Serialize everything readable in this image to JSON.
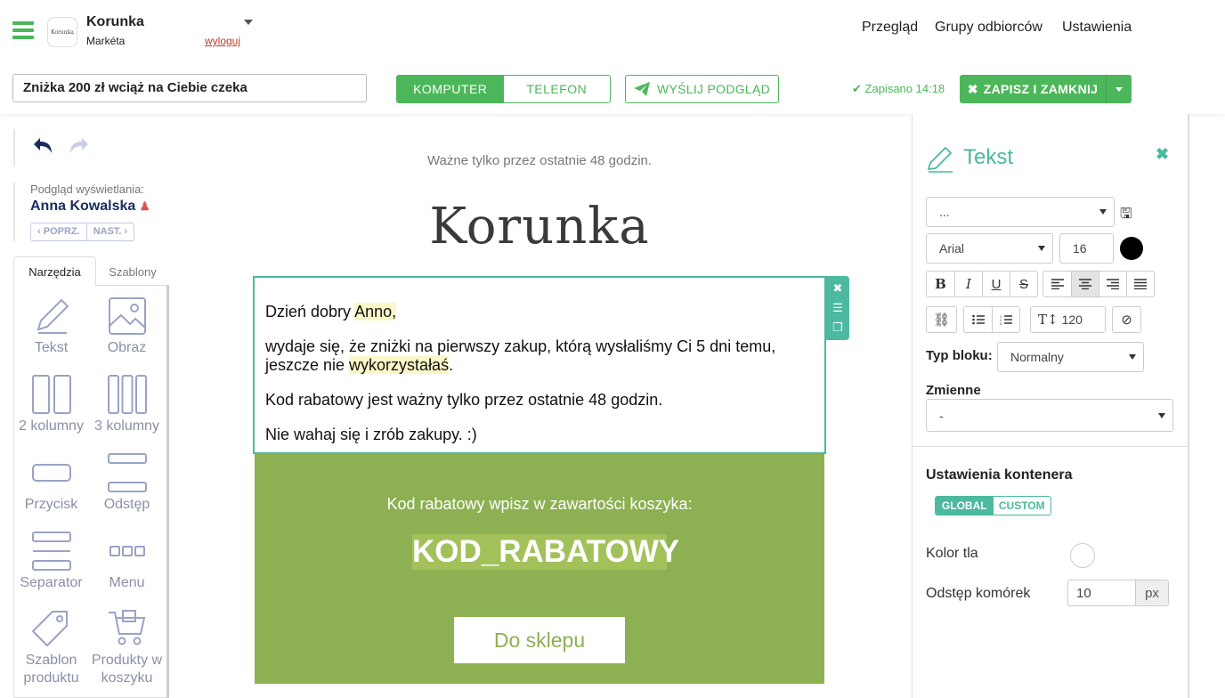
{
  "account": {
    "name": "Korunka",
    "user": "Markéta",
    "logout": "wyloguj",
    "logo_text": "Korunka"
  },
  "nav": {
    "overview": "Przegląd",
    "groups": "Grupy odbiorców",
    "settings": "Ustawienia"
  },
  "toolbar": {
    "subject": "Zniżka 200 zł wciąż na Ciebie czeka",
    "view_desktop": "KOMPUTER",
    "view_phone": "TELEFON",
    "send_preview": "WYŚLIJ PODGLĄD",
    "saved": "Zapisano 14:18",
    "save_close": "ZAPISZ I ZAMKNIJ"
  },
  "preview": {
    "label": "Podgląd wyświetlania:",
    "name": "Anna Kowalska",
    "prev": "POPRZ.",
    "next": "NAST."
  },
  "tabs": {
    "tools": "Narzędzia",
    "templates": "Szablony"
  },
  "tools": [
    {
      "label": "Tekst",
      "icon": "pencil-icon"
    },
    {
      "label": "Obraz",
      "icon": "image-icon"
    },
    {
      "label": "2 kolumny",
      "icon": "two-columns-icon"
    },
    {
      "label": "3 kolumny",
      "icon": "three-columns-icon"
    },
    {
      "label": "Przycisk",
      "icon": "button-icon"
    },
    {
      "label": "Odstęp",
      "icon": "spacer-icon"
    },
    {
      "label": "Separator",
      "icon": "separator-icon"
    },
    {
      "label": "Menu",
      "icon": "menu-icon"
    },
    {
      "label": "Szablon produktu",
      "icon": "tag-icon"
    },
    {
      "label": "Produkty w koszyku",
      "icon": "cart-icon"
    }
  ],
  "email": {
    "tagline": "Ważne tylko przez ostatnie 48 godzin.",
    "logo": "Korunka",
    "greeting_prefix": "Dzień dobry ",
    "greeting_name": "Anno,",
    "para1_prefix": "wydaje się, że zniżki na pierwszy zakup, którą wysłaliśmy Ci 5 dni temu, jeszcze nie ",
    "para1_highlight": "wykorzystałaś",
    "para1_suffix": ".",
    "para2": "Kod rabatowy jest ważny tylko przez ostatnie 48 godzin.",
    "para3": "Nie wahaj się i zrób zakupy. :)",
    "code_label": "Kod rabatowy wpisz w zawartości koszyka:",
    "code": "KOD_RABATOWY",
    "shop_button": "Do sklepu"
  },
  "right_panel": {
    "title": "Tekst",
    "style_select": "...",
    "font": "Arial",
    "font_size": "16",
    "line_height": "120",
    "block_type_label": "Typ bloku:",
    "block_type": "Normalny",
    "variables_label": "Zmienne",
    "variables_value": "-",
    "container_title": "Ustawienia kontenera",
    "global": "GLOBAL",
    "custom": "CUSTOM",
    "bg_color_label": "Kolor tla",
    "cell_spacing_label": "Odstęp komórek",
    "cell_spacing": "10",
    "unit": "px"
  },
  "colors": {
    "accent": "#4cb75a",
    "teal": "#4cb9a0",
    "green_block": "#8db052",
    "navy": "#1a2b5e"
  }
}
